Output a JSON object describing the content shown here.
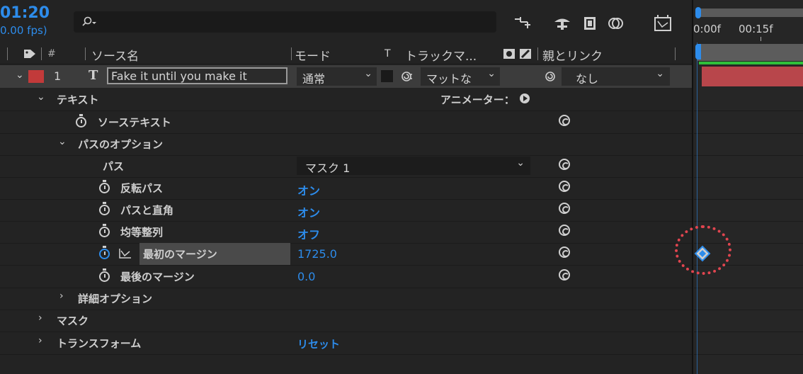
{
  "header": {
    "timecode": "01:20",
    "fps": "0.00 fps)",
    "search_placeholder": ""
  },
  "columns": {
    "hash": "#",
    "source_name": "ソース名",
    "mode": "モード",
    "t": "T",
    "track_matte": "トラックマ...",
    "parent_link": "親とリンク"
  },
  "timeline": {
    "ruler_labels": [
      "0:00f",
      "00:15f"
    ]
  },
  "layer": {
    "number": "1",
    "type_glyph": "T",
    "name": "Fake it until you make it",
    "mode": "通常",
    "matte": "マットな",
    "parent": "なし",
    "label_color": "#c23a3a"
  },
  "properties": {
    "text_group": "テキスト",
    "animator_label": "アニメーター：",
    "source_text": "ソーステキスト",
    "path_options": "パスのオプション",
    "path": "パス",
    "path_value": "マスク 1",
    "reverse_path": "反転パス",
    "reverse_path_value": "オン",
    "perpendicular": "パスと直角",
    "perpendicular_value": "オン",
    "force_align": "均等整列",
    "force_align_value": "オフ",
    "first_margin": "最初のマージン",
    "first_margin_value": "1725.0",
    "last_margin": "最後のマージン",
    "last_margin_value": "0.0",
    "more_options": "詳細オプション",
    "masks": "マスク",
    "transform": "トランスフォーム",
    "transform_value": "リセット"
  },
  "colors": {
    "accent_blue": "#2d8ceb",
    "highlight_ring": "#e0454f",
    "layer_bar": "#b8464b",
    "work_area": "#2fbf3a"
  }
}
